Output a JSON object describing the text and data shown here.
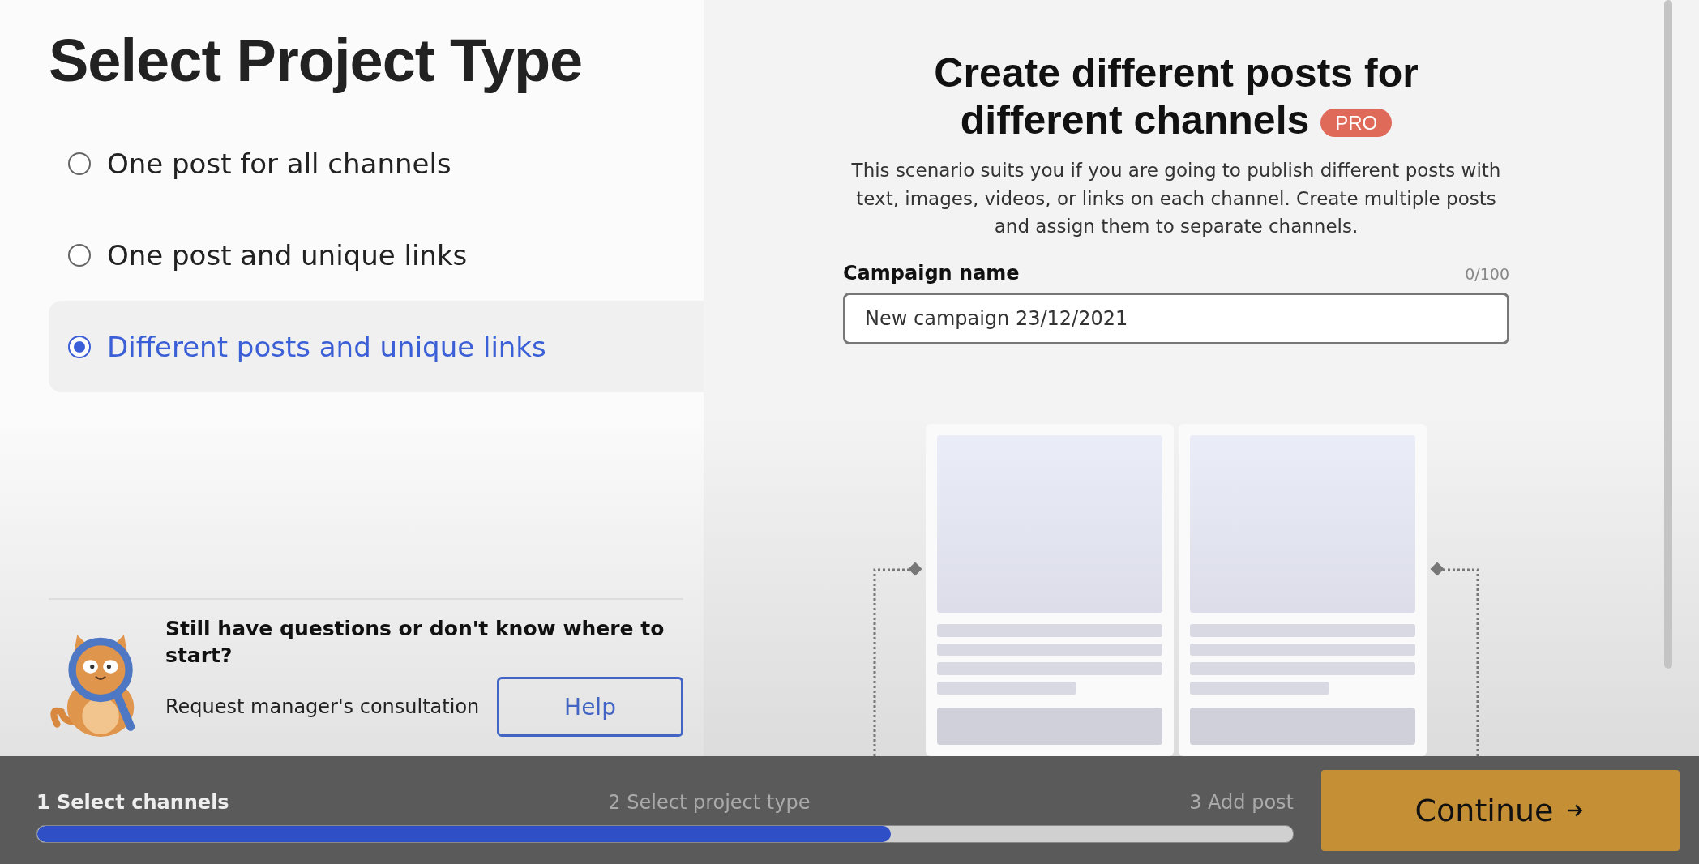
{
  "left_panel": {
    "title": "Select Project Type",
    "options": [
      {
        "label": "One post for all channels",
        "selected": false
      },
      {
        "label": "One post and unique links",
        "selected": false
      },
      {
        "label": "Different posts and unique links",
        "selected": true
      }
    ],
    "help": {
      "question": "Still have questions or don't know where to start?",
      "text": "Request manager's consultation",
      "button": "Help"
    }
  },
  "right_panel": {
    "heading": "Create different posts for different channels",
    "badge": "PRO",
    "description": "This scenario suits you if you are going to publish different posts with text, images, videos, or links on each channel. Create multiple posts and assign them to separate channels.",
    "field": {
      "label": "Campaign name",
      "counter": "0/100",
      "value": "New campaign 23/12/2021"
    }
  },
  "footer": {
    "steps": [
      {
        "label": "1 Select channels",
        "active": true
      },
      {
        "label": "2 Select project type",
        "active": false
      },
      {
        "label": "3 Add post",
        "active": false
      }
    ],
    "progress": {
      "level": 0.68
    },
    "button": "Continue"
  }
}
